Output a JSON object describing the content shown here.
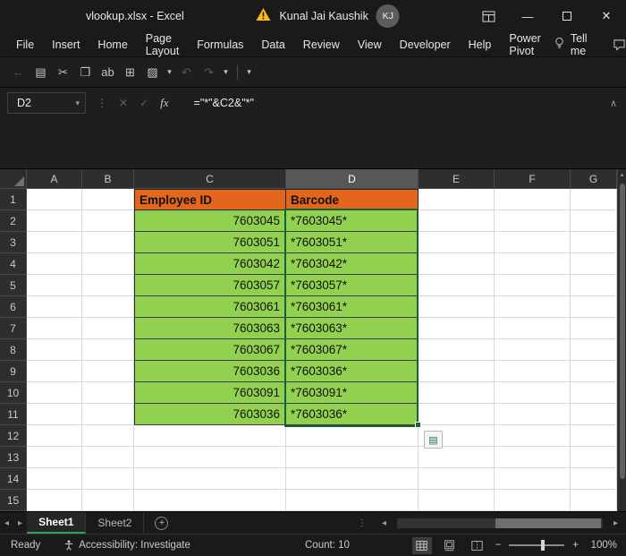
{
  "titlebar": {
    "title": "vlookup.xlsx - Excel",
    "user_name": "Kunal Jai Kaushik",
    "avatar_initials": "KJ"
  },
  "menubar": {
    "tabs": [
      {
        "label": "File"
      },
      {
        "label": "Insert"
      },
      {
        "label": "Home"
      },
      {
        "label": "Page Layout"
      },
      {
        "label": "Formulas"
      },
      {
        "label": "Data"
      },
      {
        "label": "Review"
      },
      {
        "label": "View"
      },
      {
        "label": "Developer"
      },
      {
        "label": "Help"
      },
      {
        "label": "Power Pivot"
      }
    ],
    "tell_me": "Tell me"
  },
  "formula_bar": {
    "name_box": "D2",
    "fx_label": "fx",
    "formula": "=\"*\"&C2&\"*\""
  },
  "grid": {
    "column_headers": [
      "A",
      "B",
      "C",
      "D",
      "E",
      "F",
      "G"
    ],
    "row_headers": [
      "1",
      "2",
      "3",
      "4",
      "5",
      "6",
      "7",
      "8",
      "9",
      "10",
      "11",
      "12",
      "13",
      "14",
      "15"
    ],
    "header_row": {
      "employee_id": "Employee ID",
      "barcode": "Barcode"
    },
    "rows": [
      {
        "id": "7603045",
        "barcode": "*7603045*"
      },
      {
        "id": "7603051",
        "barcode": "*7603051*"
      },
      {
        "id": "7603042",
        "barcode": "*7603042*"
      },
      {
        "id": "7603057",
        "barcode": "*7603057*"
      },
      {
        "id": "7603061",
        "barcode": "*7603061*"
      },
      {
        "id": "7603063",
        "barcode": "*7603063*"
      },
      {
        "id": "7603067",
        "barcode": "*7603067*"
      },
      {
        "id": "7603036",
        "barcode": "*7603036*"
      },
      {
        "id": "7603091",
        "barcode": "*7603091*"
      },
      {
        "id": "7603036",
        "barcode": "*7603036*"
      }
    ],
    "selected_cell": "D2",
    "selected_range": "D2:D11"
  },
  "sheet_tabs": {
    "tabs": [
      {
        "label": "Sheet1"
      },
      {
        "label": "Sheet2"
      }
    ]
  },
  "status_bar": {
    "mode": "Ready",
    "accessibility": "Accessibility: Investigate",
    "count": "Count: 10",
    "zoom": "100%"
  },
  "colors": {
    "accent_green": "#217346",
    "header_orange": "#E2661C",
    "cell_green": "#92D050"
  },
  "icons": {
    "back": "←",
    "paste": "▤",
    "cut": "✂",
    "copy": "❐",
    "spell": "ab",
    "border": "⊞",
    "fill": "▨",
    "undo": "↶",
    "redo": "↷",
    "dropdown": "▾",
    "dots": "⋮",
    "cancel": "✕",
    "enter": "✓",
    "collapse": "∧",
    "scroll_up": "▴",
    "nav_left": "◂",
    "nav_right": "▸",
    "add": "+",
    "minimize": "—",
    "close": "✕",
    "zoom_minus": "−",
    "zoom_plus": "+",
    "autofill": "▤"
  }
}
